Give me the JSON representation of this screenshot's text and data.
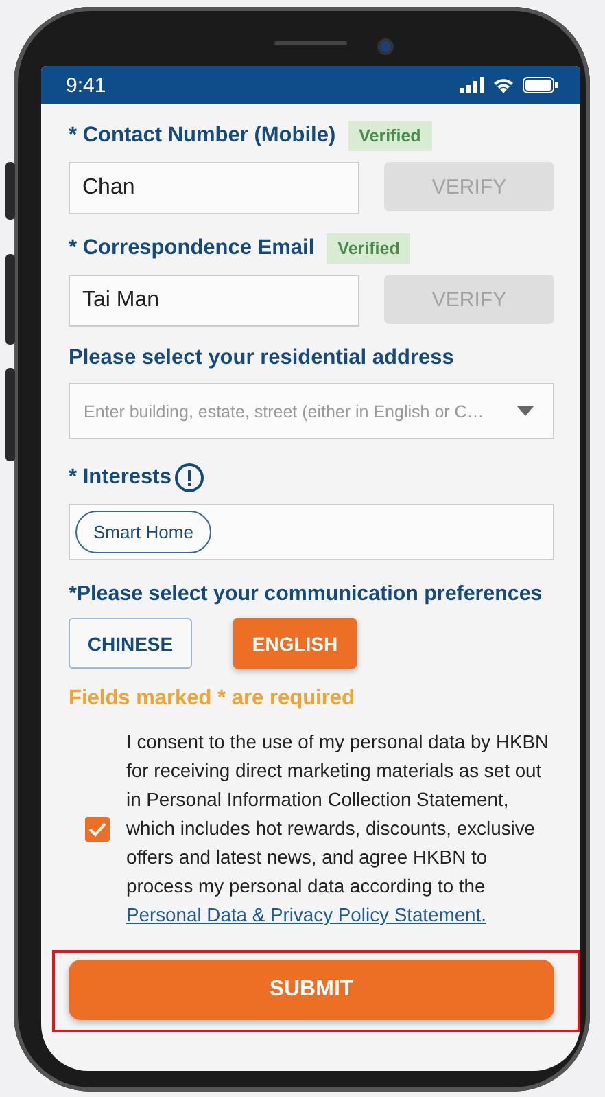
{
  "status_bar": {
    "time": "9:41"
  },
  "verify_fields": [
    {
      "label": "* Contact Number (Mobile)",
      "badge": "Verified",
      "value": "Chan",
      "button": "VERIFY",
      "disabled": true
    },
    {
      "label": "* Correspondence Email",
      "badge": "Verified",
      "value": "Tai Man",
      "button": "VERIFY",
      "disabled": true
    }
  ],
  "address": {
    "label": "Please select your residential address",
    "placeholder": "Enter building, estate, street (either in English or C…"
  },
  "interests": {
    "label": "* Interests",
    "tags": [
      "Smart Home"
    ]
  },
  "preferences": {
    "label": "*Please select your communication preferences",
    "options": [
      {
        "label": "CHINESE",
        "selected": false
      },
      {
        "label": "ENGLISH",
        "selected": true
      }
    ]
  },
  "required_note": "Fields marked * are required",
  "consent": {
    "checked": true,
    "text": "I consent to the use of my personal data by HKBN for receiving direct marketing materials as set out in Personal Information Collection Statement, which includes hot rewards, discounts, exclusive offers and latest news, and agree HKBN to process my personal data according to the",
    "link": "Personal Data & Privacy Policy Statement."
  },
  "submit": "SUBMIT"
}
